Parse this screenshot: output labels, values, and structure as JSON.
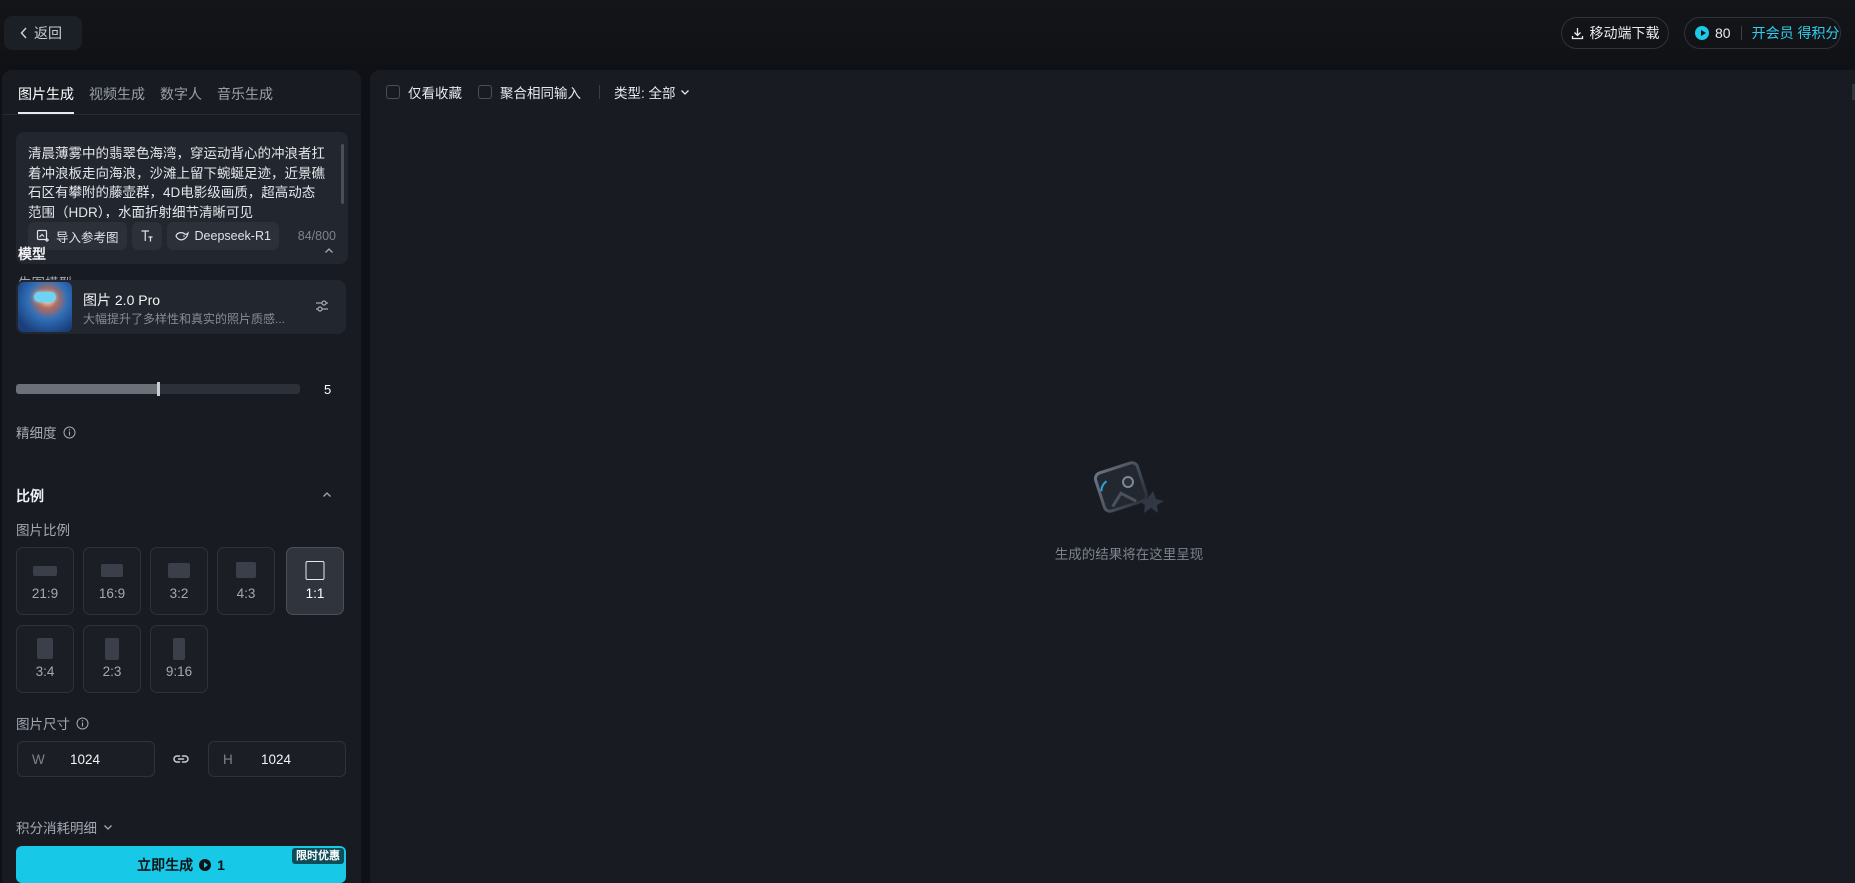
{
  "header": {
    "back_label": "返回",
    "download_label": "移动端下载",
    "points": "80",
    "vip_label": "开会员 得积分"
  },
  "tabs": [
    {
      "label": "图片生成",
      "active": true
    },
    {
      "label": "视频生成",
      "active": false
    },
    {
      "label": "数字人",
      "active": false
    },
    {
      "label": "音乐生成",
      "active": false
    }
  ],
  "prompt": {
    "text": "清晨薄雾中的翡翠色海湾，穿运动背心的冲浪者扛着冲浪板走向海浪，沙滩上留下蜿蜒足迹，近景礁石区有攀附的藤壶群，4D电影级画质，超高动态范围（HDR），水面折射细节清晰可见",
    "import_ref_label": "导入参考图",
    "deepseek_label": "Deepseek-R1",
    "char_count": "84/800"
  },
  "model_section": {
    "title": "模型",
    "sub_label": "生图模型",
    "model_name": "图片 2.0 Pro",
    "model_desc": "大幅提升了多样性和真实的照片质感..."
  },
  "fineness": {
    "label": "精细度",
    "value": "5",
    "fraction": 0.5
  },
  "ratio_section": {
    "title": "比例",
    "sub_label": "图片比例",
    "options": [
      {
        "label": "21:9",
        "selected": false
      },
      {
        "label": "16:9",
        "selected": false
      },
      {
        "label": "3:2",
        "selected": false
      },
      {
        "label": "4:3",
        "selected": false
      },
      {
        "label": "1:1",
        "selected": true
      },
      {
        "label": "3:4",
        "selected": false
      },
      {
        "label": "2:3",
        "selected": false
      },
      {
        "label": "9:16",
        "selected": false
      }
    ]
  },
  "size_section": {
    "label": "图片尺寸",
    "width_prefix": "W",
    "width_value": "1024",
    "height_prefix": "H",
    "height_value": "1024"
  },
  "cost_detail_label": "积分消耗明细",
  "generate": {
    "label": "立即生成",
    "cost": "1",
    "badge": "限时优惠"
  },
  "filters": {
    "favorites_label": "仅看收藏",
    "merge_label": "聚合相同输入",
    "type_label": "类型: 全部"
  },
  "empty_state": {
    "text": "生成的结果将在这里呈现"
  },
  "colors": {
    "accent": "#17c9e6",
    "background": "#0f1116",
    "panel": "#181b22"
  }
}
